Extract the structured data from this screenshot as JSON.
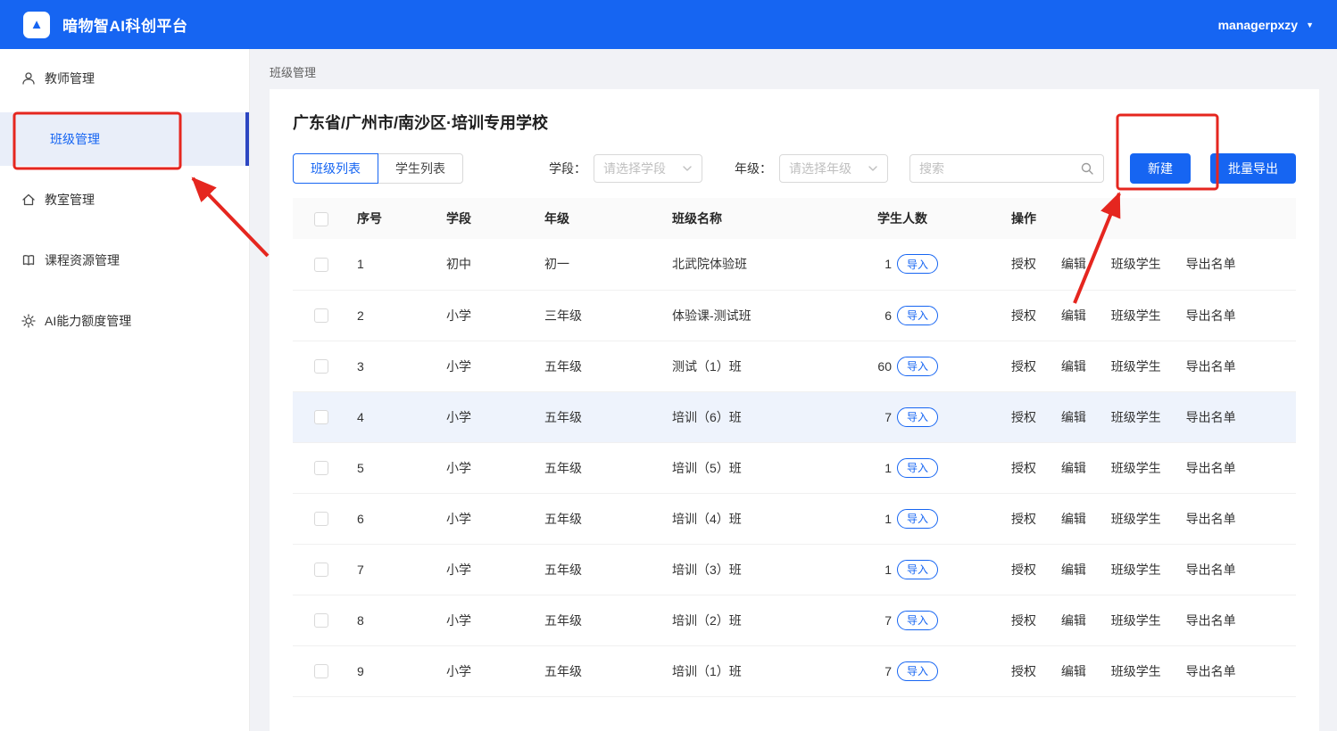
{
  "colors": {
    "primary": "#1665f2",
    "annotation": "#e5261f",
    "active_bar": "#2c46c2",
    "row_highlight": "#eef3fc"
  },
  "header": {
    "app_title": "暗物智AI科创平台",
    "username": "managerpxzy"
  },
  "sidebar": {
    "items": [
      {
        "label": "教师管理",
        "icon": "user-icon",
        "active": false
      },
      {
        "label": "班级管理",
        "icon": null,
        "active": true
      },
      {
        "label": "教室管理",
        "icon": "home-icon",
        "active": false
      },
      {
        "label": "课程资源管理",
        "icon": "resource-icon",
        "active": false
      },
      {
        "label": "AI能力额度管理",
        "icon": "gear-icon",
        "active": false
      }
    ]
  },
  "breadcrumb": "班级管理",
  "main": {
    "school_title": "广东省/广州市/南沙区·培训专用学校",
    "tabs": [
      {
        "label": "班级列表",
        "active": true
      },
      {
        "label": "学生列表",
        "active": false
      }
    ],
    "filters": {
      "stage_label": "学段：",
      "stage_placeholder": "请选择学段",
      "grade_label": "年级：",
      "grade_placeholder": "请选择年级",
      "search_placeholder": "搜索"
    },
    "actions": {
      "create": "新建",
      "batch_export": "批量导出"
    },
    "table": {
      "columns": [
        "序号",
        "学段",
        "年级",
        "班级名称",
        "学生人数",
        "操作"
      ],
      "import_label": "导入",
      "row_actions": [
        {
          "key": "authorize",
          "label": "授权"
        },
        {
          "key": "edit",
          "label": "编辑"
        },
        {
          "key": "class-students",
          "label": "班级学生"
        },
        {
          "key": "export-roster",
          "label": "导出名单"
        }
      ],
      "rows": [
        {
          "no": "1",
          "stage": "初中",
          "grade": "初一",
          "name": "北武院体验班",
          "students": "1",
          "highlight": false
        },
        {
          "no": "2",
          "stage": "小学",
          "grade": "三年级",
          "name": "体验课-测试班",
          "students": "6",
          "highlight": false
        },
        {
          "no": "3",
          "stage": "小学",
          "grade": "五年级",
          "name": "测试（1）班",
          "students": "60",
          "highlight": false
        },
        {
          "no": "4",
          "stage": "小学",
          "grade": "五年级",
          "name": "培训（6）班",
          "students": "7",
          "highlight": true
        },
        {
          "no": "5",
          "stage": "小学",
          "grade": "五年级",
          "name": "培训（5）班",
          "students": "1",
          "highlight": false
        },
        {
          "no": "6",
          "stage": "小学",
          "grade": "五年级",
          "name": "培训（4）班",
          "students": "1",
          "highlight": false
        },
        {
          "no": "7",
          "stage": "小学",
          "grade": "五年级",
          "name": "培训（3）班",
          "students": "1",
          "highlight": false
        },
        {
          "no": "8",
          "stage": "小学",
          "grade": "五年级",
          "name": "培训（2）班",
          "students": "7",
          "highlight": false
        },
        {
          "no": "9",
          "stage": "小学",
          "grade": "五年级",
          "name": "培训（1）班",
          "students": "7",
          "highlight": false
        }
      ]
    }
  },
  "annotations": {
    "highlighted_targets": [
      "sidebar-item-class-management",
      "create-button"
    ]
  }
}
